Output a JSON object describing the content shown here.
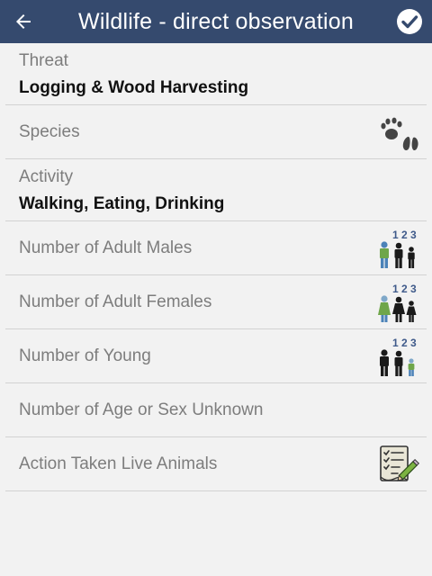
{
  "app": {
    "title": "Wildlife - direct observation",
    "back_icon": "arrow-left-icon",
    "confirm_icon": "check-circle-icon",
    "bar_color": "#354a6e"
  },
  "fields": {
    "threat": {
      "label": "Threat",
      "value": "Logging & Wood Harvesting"
    },
    "species": {
      "label": "Species",
      "icon": "animal-tracks-icon"
    },
    "activity": {
      "label": "Activity",
      "value": "Walking, Eating, Drinking"
    },
    "adult_males": {
      "label": "Number of Adult Males",
      "icon": "adult-males-count-icon",
      "icon_digits": "1 2 3"
    },
    "adult_females": {
      "label": "Number of Adult Females",
      "icon": "adult-females-count-icon",
      "icon_digits": "1 2 3"
    },
    "young": {
      "label": "Number of Young",
      "icon": "young-count-icon",
      "icon_digits": "1 2 3"
    },
    "unknown": {
      "label": "Number of Age or Sex Unknown"
    },
    "action_taken": {
      "label": "Action Taken Live Animals",
      "icon": "checklist-pencil-icon"
    }
  }
}
